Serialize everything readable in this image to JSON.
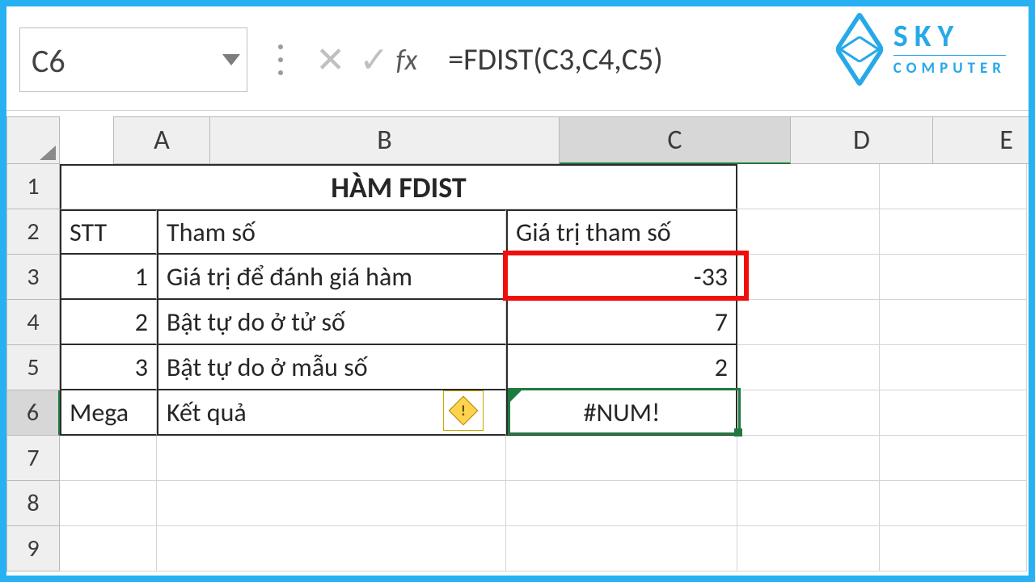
{
  "brand": {
    "name": "SKY",
    "sub": "COMPUTER"
  },
  "namebox": {
    "ref": "C6"
  },
  "formula_bar": {
    "fx_label": "fx",
    "formula": "=FDIST(C3,C4,C5)"
  },
  "columns": [
    "A",
    "B",
    "C",
    "D",
    "E"
  ],
  "row_labels": [
    "1",
    "2",
    "3",
    "4",
    "5",
    "6",
    "7",
    "8",
    "9"
  ],
  "title": "HÀM FDIST",
  "header": {
    "a": "STT",
    "b": "Tham số",
    "c": "Giá trị tham số"
  },
  "rows": [
    {
      "a": "1",
      "b": "Giá trị để đánh giá hàm",
      "c": "-33"
    },
    {
      "a": "2",
      "b": "Bật tự do ở tử số",
      "c": "7"
    },
    {
      "a": "3",
      "b": "Bật tự do ở mẫu số",
      "c": "2"
    }
  ],
  "result_row": {
    "a": "Mega",
    "b": "Kết quả",
    "c": "#NUM!"
  },
  "smarttag": {
    "char": "!"
  },
  "selected": {
    "col": "C",
    "row": "6"
  }
}
